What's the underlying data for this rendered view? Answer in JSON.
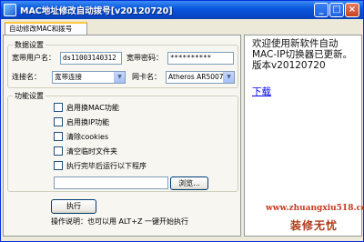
{
  "window": {
    "title": "MAC地址修改自动拨号[v20120720]"
  },
  "tab": {
    "label": "自动修改MAC和拨号"
  },
  "data_settings": {
    "legend": "数据设置",
    "username_label": "宽带用户名：",
    "username_value": "ds11003140312",
    "password_label": "宽带密码：",
    "password_value": "**********",
    "connection_label": "连接名：",
    "connection_value": "宽带连接",
    "nic_label": "网卡名：",
    "nic_value": "Atheros AR5007..."
  },
  "function_settings": {
    "legend": "功能设置",
    "options": [
      {
        "label": "启用换MAC功能",
        "checked": false
      },
      {
        "label": "启用换IP功能",
        "checked": false
      },
      {
        "label": "清除cookies",
        "checked": false
      },
      {
        "label": "清空临时文件夹",
        "checked": false
      },
      {
        "label": "执行完毕后运行以下程序",
        "checked": false
      }
    ],
    "program_path": "",
    "browse_label": "浏览..."
  },
  "execute_label": "执行",
  "instructions": "操作说明：也可以用 ALT+Z 一键开始执行",
  "right_panel": {
    "welcome_text": "欢迎使用新软件自动MAC-IP切换器已更新。版本v20120720",
    "download_link": "下载"
  },
  "watermark": {
    "url": "www.zhuangxiu518.com",
    "brand": "装修无忧"
  }
}
